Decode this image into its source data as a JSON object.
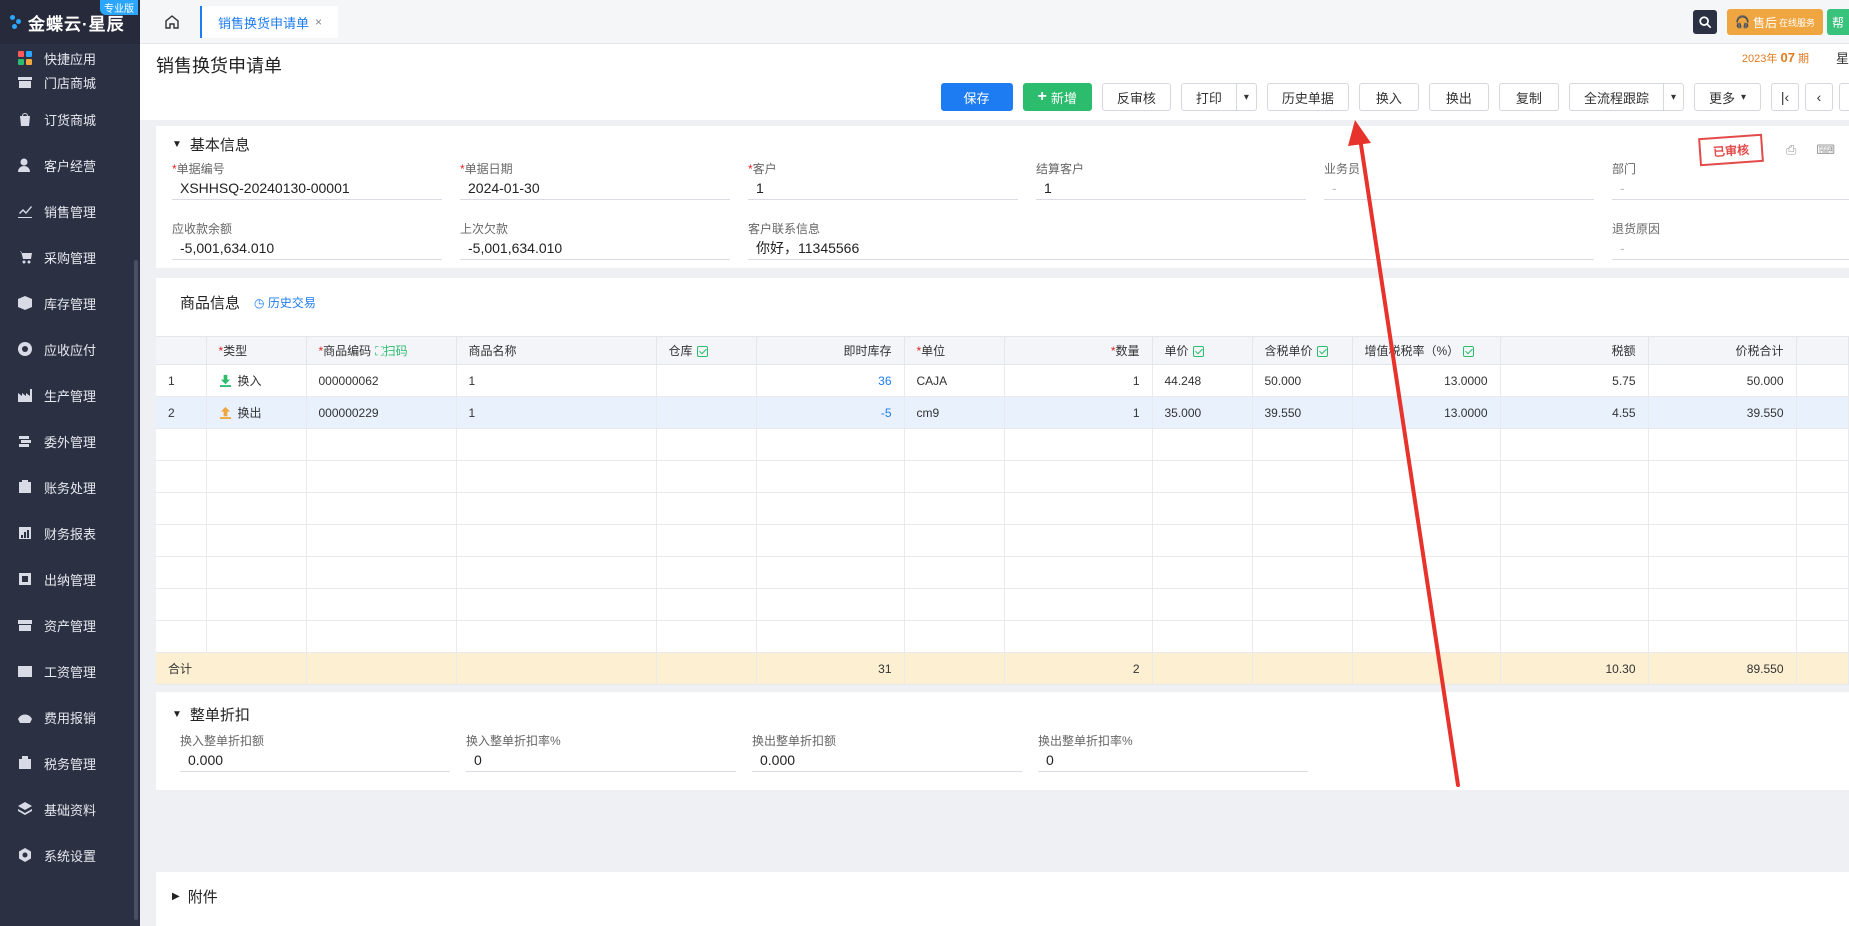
{
  "brand": {
    "name": "金蝶云·星辰",
    "edition": "专业版"
  },
  "sidebar": {
    "items": [
      {
        "label": "快捷应用",
        "icon": "apps-icon"
      },
      {
        "label": "门店商城",
        "icon": "store-icon"
      },
      {
        "label": "订货商城",
        "icon": "shopping-bag-icon"
      },
      {
        "label": "客户经营",
        "icon": "customer-icon"
      },
      {
        "label": "销售管理",
        "icon": "sales-chart-icon"
      },
      {
        "label": "采购管理",
        "icon": "cart-icon"
      },
      {
        "label": "库存管理",
        "icon": "box-icon"
      },
      {
        "label": "应收应付",
        "icon": "receivable-icon"
      },
      {
        "label": "生产管理",
        "icon": "factory-icon"
      },
      {
        "label": "委外管理",
        "icon": "outsource-icon"
      },
      {
        "label": "账务处理",
        "icon": "ledger-icon"
      },
      {
        "label": "财务报表",
        "icon": "report-icon"
      },
      {
        "label": "出纳管理",
        "icon": "cashier-icon"
      },
      {
        "label": "资产管理",
        "icon": "asset-icon"
      },
      {
        "label": "工资管理",
        "icon": "salary-icon"
      },
      {
        "label": "费用报销",
        "icon": "expense-icon"
      },
      {
        "label": "税务管理",
        "icon": "tax-icon"
      },
      {
        "label": "基础资料",
        "icon": "layers-icon"
      },
      {
        "label": "系统设置",
        "icon": "settings-icon"
      }
    ]
  },
  "topbar": {
    "tab_label": "销售换货申请单",
    "tab_close": "×",
    "service_label": "售后",
    "service_sub": "在线服务",
    "help_label": "帮"
  },
  "header": {
    "title": "销售换货申请单",
    "period_year": "2023年",
    "period_num": "07",
    "period_unit": "期",
    "period_right": "星"
  },
  "toolbar": {
    "save": "保存",
    "new": "新增",
    "unaudit": "反审核",
    "print": "打印",
    "history": "历史单据",
    "swap_in": "换入",
    "swap_out": "换出",
    "copy": "复制",
    "track": "全流程跟踪",
    "more": "更多"
  },
  "basic": {
    "title": "基本信息",
    "stamp": "已审核",
    "fields": {
      "bill_no": {
        "label": "单据编号",
        "value": "XSHHSQ-20240130-00001"
      },
      "bill_date": {
        "label": "单据日期",
        "value": "2024-01-30"
      },
      "customer": {
        "label": "客户",
        "value": "1"
      },
      "settle_customer": {
        "label": "结算客户",
        "value": "1"
      },
      "salesman": {
        "label": "业务员",
        "value": "-"
      },
      "department": {
        "label": "部门",
        "value": "-"
      },
      "receivable": {
        "label": "应收款余额",
        "value": "-5,001,634.010"
      },
      "last_debt": {
        "label": "上次欠款",
        "value": "-5,001,634.010"
      },
      "contact": {
        "label": "客户联系信息",
        "value": "你好，11345566"
      },
      "return_reason": {
        "label": "退货原因",
        "value": "-"
      }
    }
  },
  "goods": {
    "title": "商品信息",
    "history_link": "历史交易",
    "columns": {
      "type": "类型",
      "code": "商品编码",
      "scan": "扫码",
      "name": "商品名称",
      "warehouse": "仓库",
      "stock": "即时库存",
      "unit": "单位",
      "qty": "数量",
      "price": "单价",
      "tax_price": "含税单价",
      "tax_rate": "增值税税率（%）",
      "tax": "税额",
      "total": "价税合计"
    },
    "rows": [
      {
        "idx": "1",
        "type": "换入",
        "code": "000000062",
        "name": "1",
        "warehouse": "",
        "stock": "36",
        "unit": "CAJA",
        "qty": "1",
        "price": "44.248",
        "tax_price": "50.000",
        "tax_rate": "13.0000",
        "tax": "5.75",
        "total": "50.000"
      },
      {
        "idx": "2",
        "type": "换出",
        "code": "000000229",
        "name": "1",
        "warehouse": "",
        "stock": "-5",
        "unit": "cm9",
        "qty": "1",
        "price": "35.000",
        "tax_price": "39.550",
        "tax_rate": "13.0000",
        "tax": "4.55",
        "total": "39.550"
      }
    ],
    "total": {
      "label": "合计",
      "stock": "31",
      "qty": "2",
      "tax": "10.30",
      "total": "89.550"
    }
  },
  "discount": {
    "title": "整单折扣",
    "in_amount": {
      "label": "换入整单折扣额",
      "value": "0.000"
    },
    "in_rate": {
      "label": "换入整单折扣率%",
      "value": "0"
    },
    "out_amount": {
      "label": "换出整单折扣额",
      "value": "0.000"
    },
    "out_rate": {
      "label": "换出整单折扣率%",
      "value": "0"
    }
  },
  "attachment": {
    "title": "附件"
  },
  "colors": {
    "primary": "#1e7cf2",
    "green": "#2bbd6d",
    "annotation": "#e8322c",
    "sidebar": "#2c3043"
  }
}
